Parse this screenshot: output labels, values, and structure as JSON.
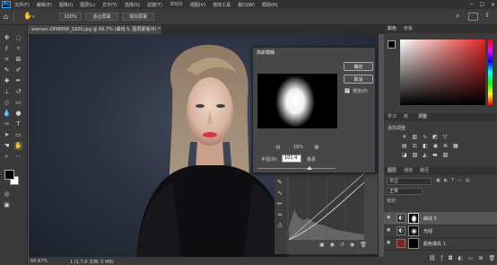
{
  "app": {
    "logo": "Ps",
    "menu": [
      "文件(F)",
      "编辑(E)",
      "图像(I)",
      "图层(L)",
      "文字(Y)",
      "选择(S)",
      "滤镜(T)",
      "3D(D)",
      "视图(V)",
      "增效工具",
      "窗口(W)",
      "帮助(H)"
    ]
  },
  "options": {
    "zoom_btn": "100%",
    "fit_btn": "适合屏幕",
    "fill_btn": "填充屏幕"
  },
  "document": {
    "tab_title": "woman-2998996_1920.jpg @ 66.7% (曲线 5, 图层蒙版/8) *",
    "status_zoom": "66.67%",
    "status_info": "1 (1.7.0 文档: 5 MB)"
  },
  "dialog": {
    "title": "高斯模糊",
    "ok": "确定",
    "cancel": "取消",
    "preview_label": "预览(P)",
    "preview_checked": true,
    "zoom": "16%",
    "radius_label": "半径(R):",
    "radius_value": "101.4",
    "radius_unit": "像素"
  },
  "panels": {
    "color_tabs": [
      "颜色",
      "色板"
    ],
    "mid_tabs": [
      "学习",
      "库",
      "调整"
    ],
    "adj_title": "添加调整",
    "layer_tabs": [
      "图层",
      "通道",
      "路径"
    ],
    "search_placeholder": "类型",
    "blend_mode": "正常",
    "lock_label": "锁定:",
    "layers": [
      {
        "name": "曲线 5",
        "selected": true
      },
      {
        "name": "光线",
        "selected": false
      },
      {
        "name": "颜色填充 1",
        "selected": false
      }
    ]
  },
  "colors": {
    "accent": "#31a8ff",
    "foreground": "#000000",
    "background": "#ffffff",
    "fill_layer": "#8a1c1c"
  }
}
